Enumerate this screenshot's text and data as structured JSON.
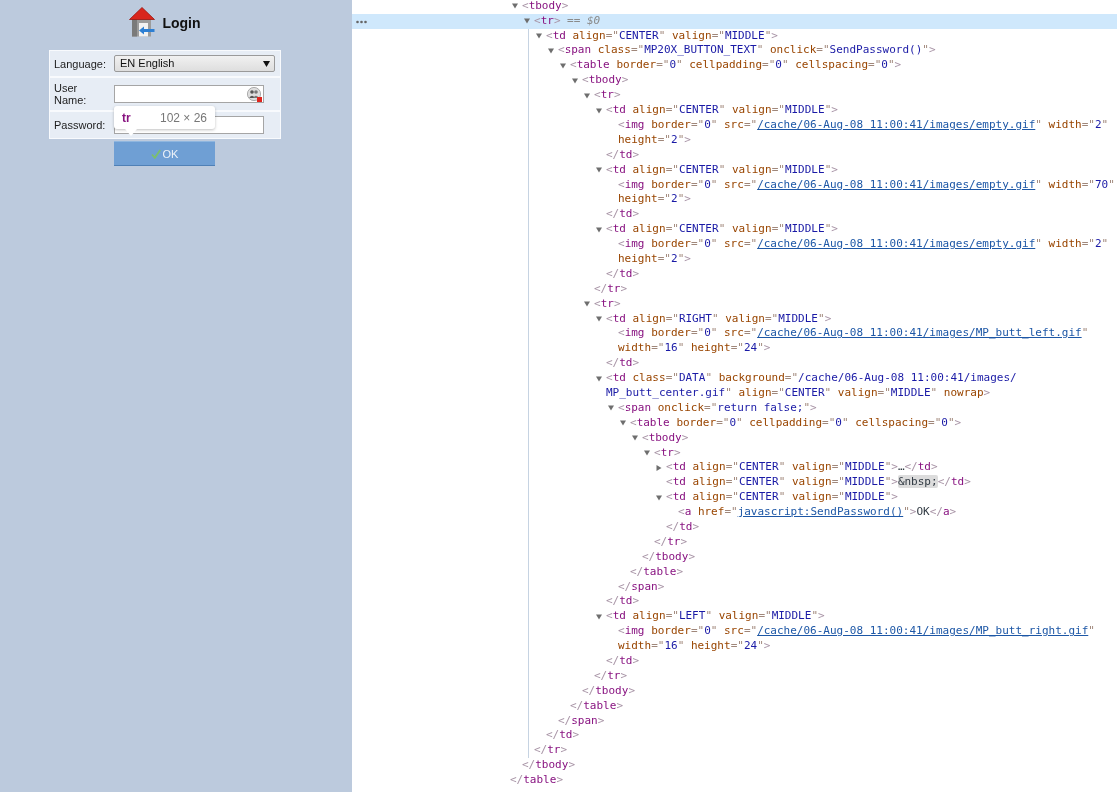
{
  "login_page": {
    "title": "Login",
    "fields": [
      {
        "label": "Language:",
        "kind": "select",
        "value": "EN English"
      },
      {
        "label": "User Name:",
        "kind": "text"
      },
      {
        "label": "Password:",
        "kind": "password"
      }
    ],
    "submit_button": "OK"
  },
  "inspect_tooltip": {
    "tag": "tr",
    "size": "102 × 26"
  },
  "elements_panel": {
    "tree": {
      "close": "</table>",
      "children": [
        {
          "kind": "parent",
          "open": [
            {
              "kind": "markup",
              "text": "<tbody>"
            }
          ],
          "expanded": true,
          "selected": false,
          "close": "</tbody>",
          "children": [
            {
              "kind": "parent",
              "open": [
                {
                  "kind": "markup",
                  "text": "<tr>"
                }
              ],
              "suffix": "== $0",
              "expanded": true,
              "selected": true,
              "close": "</tr>",
              "children": [
                {
                  "kind": "parent",
                  "open": [
                    {
                      "kind": "markup",
                      "text": "<td align=\"CENTER\" valign=\"MIDDLE\">"
                    }
                  ],
                  "expanded": true,
                  "selected": false,
                  "close": "</td>",
                  "children": [
                    {
                      "kind": "parent",
                      "open": [
                        {
                          "kind": "markup",
                          "text": "<span class=\"MP20X_BUTTON_TEXT\" onclick=\"SendPassword()\">"
                        }
                      ],
                      "expanded": true,
                      "selected": false,
                      "close": "</span>",
                      "children": [
                        {
                          "kind": "parent",
                          "open": [
                            {
                              "kind": "markup",
                              "text": "<table border=\"0\" cellpadding=\"0\" cellspacing=\"0\">"
                            }
                          ],
                          "expanded": true,
                          "selected": false,
                          "close": "</table>",
                          "children": [
                            {
                              "kind": "parent",
                              "open": [
                                {
                                  "kind": "markup",
                                  "text": "<tbody>"
                                }
                              ],
                              "expanded": true,
                              "selected": false,
                              "close": "</tbody>",
                              "children": [
                                {
                                  "kind": "parent",
                                  "open": [
                                    {
                                      "kind": "markup",
                                      "text": "<tr>"
                                    }
                                  ],
                                  "expanded": true,
                                  "selected": false,
                                  "close": "</tr>",
                                  "children": [
                                    {
                                      "kind": "parent",
                                      "open": [
                                        {
                                          "kind": "markup",
                                          "text": "<td align=\"CENTER\" valign=\"MIDDLE\">"
                                        }
                                      ],
                                      "expanded": true,
                                      "selected": false,
                                      "close": "</td>",
                                      "children": [
                                        {
                                          "kind": "leaf",
                                          "open": [
                                            {
                                              "kind": "markup",
                                              "text": "<img border=\"0\" src=\""
                                            },
                                            {
                                              "kind": "link",
                                              "text": "/cache/06-Aug-08 11:00:41/images/empty.gif"
                                            },
                                            {
                                              "kind": "markup",
                                              "text": "\" width=\"2\""
                                            },
                                            {
                                              "kind": "markup",
                                              "text": " height=\"2\">"
                                            }
                                          ],
                                          "selected": false
                                        }
                                      ]
                                    },
                                    {
                                      "kind": "parent",
                                      "open": [
                                        {
                                          "kind": "markup",
                                          "text": "<td align=\"CENTER\" valign=\"MIDDLE\">"
                                        }
                                      ],
                                      "expanded": true,
                                      "selected": false,
                                      "close": "</td>",
                                      "children": [
                                        {
                                          "kind": "leaf",
                                          "open": [
                                            {
                                              "kind": "markup",
                                              "text": "<img border=\"0\" src=\""
                                            },
                                            {
                                              "kind": "link",
                                              "text": "/cache/06-Aug-08 11:00:41/images/empty.gif"
                                            },
                                            {
                                              "kind": "markup",
                                              "text": "\" width=\"70\""
                                            },
                                            {
                                              "kind": "markup",
                                              "text": " height=\"2\">"
                                            }
                                          ],
                                          "selected": false
                                        }
                                      ]
                                    },
                                    {
                                      "kind": "parent",
                                      "open": [
                                        {
                                          "kind": "markup",
                                          "text": "<td align=\"CENTER\" valign=\"MIDDLE\">"
                                        }
                                      ],
                                      "expanded": true,
                                      "selected": false,
                                      "close": "</td>",
                                      "children": [
                                        {
                                          "kind": "leaf",
                                          "open": [
                                            {
                                              "kind": "markup",
                                              "text": "<img border=\"0\" src=\""
                                            },
                                            {
                                              "kind": "link",
                                              "text": "/cache/06-Aug-08 11:00:41/images/empty.gif"
                                            },
                                            {
                                              "kind": "markup",
                                              "text": "\" width=\"2\""
                                            },
                                            {
                                              "kind": "markup",
                                              "text": " height=\"2\">"
                                            }
                                          ],
                                          "selected": false
                                        }
                                      ]
                                    }
                                  ]
                                },
                                {
                                  "kind": "parent",
                                  "open": [
                                    {
                                      "kind": "markup",
                                      "text": "<tr>"
                                    }
                                  ],
                                  "expanded": true,
                                  "selected": false,
                                  "close": "</tr>",
                                  "children": [
                                    {
                                      "kind": "parent",
                                      "open": [
                                        {
                                          "kind": "markup",
                                          "text": "<td align=\"RIGHT\" valign=\"MIDDLE\">"
                                        }
                                      ],
                                      "expanded": true,
                                      "selected": false,
                                      "close": "</td>",
                                      "children": [
                                        {
                                          "kind": "leaf",
                                          "open": [
                                            {
                                              "kind": "markup",
                                              "text": "<img border=\"0\" src=\""
                                            },
                                            {
                                              "kind": "link",
                                              "text": "/cache/06-Aug-08 11:00:41/images/MP_butt_left.gif"
                                            },
                                            {
                                              "kind": "markup",
                                              "text": "\""
                                            },
                                            {
                                              "kind": "markup",
                                              "text": " width=\"16\" height=\"24\">"
                                            }
                                          ],
                                          "selected": false
                                        }
                                      ]
                                    },
                                    {
                                      "kind": "parent",
                                      "open": [
                                        {
                                          "kind": "markup",
                                          "text": "<td class=\"DATA\" background=\"/cache/06-Aug-08 11:00:41/images/MP_butt_center.gif\" align=\"CENTER\" valign=\"MIDDLE\" nowrap>"
                                        }
                                      ],
                                      "expanded": true,
                                      "selected": false,
                                      "close": "</td>",
                                      "children": [
                                        {
                                          "kind": "parent",
                                          "open": [
                                            {
                                              "kind": "markup",
                                              "text": "<span onclick=\"return false;\">"
                                            }
                                          ],
                                          "expanded": true,
                                          "selected": false,
                                          "close": "</span>",
                                          "children": [
                                            {
                                              "kind": "parent",
                                              "open": [
                                                {
                                                  "kind": "markup",
                                                  "text": "<table border=\"0\" cellpadding=\"0\" cellspacing=\"0\">"
                                                }
                                              ],
                                              "expanded": true,
                                              "selected": false,
                                              "close": "</table>",
                                              "children": [
                                                {
                                                  "kind": "parent",
                                                  "open": [
                                                    {
                                                      "kind": "markup",
                                                      "text": "<tbody>"
                                                    }
                                                  ],
                                                  "expanded": true,
                                                  "selected": false,
                                                  "close": "</tbody>",
                                                  "children": [
                                                    {
                                                      "kind": "parent",
                                                      "open": [
                                                        {
                                                          "kind": "markup",
                                                          "text": "<tr>"
                                                        }
                                                      ],
                                                      "expanded": true,
                                                      "selected": false,
                                                      "close": "</tr>",
                                                      "children": [
                                                        {
                                                          "kind": "parent",
                                                          "open": [
                                                            {
                                                              "kind": "markup",
                                                              "text": "<td align=\"CENTER\" valign=\"MIDDLE\">"
                                                            }
                                                          ],
                                                          "summary": "…",
                                                          "expanded": false,
                                                          "selected": false,
                                                          "close": "</td>"
                                                        },
                                                        {
                                                          "kind": "inline",
                                                          "open": [
                                                            {
                                                              "kind": "markup",
                                                              "text": "<td align=\"CENTER\" valign=\"MIDDLE\">"
                                                            }
                                                          ],
                                                          "content": {
                                                            "text": "&nbsp;",
                                                            "kind": "entity"
                                                          },
                                                          "close": "</td>",
                                                          "selected": false
                                                        },
                                                        {
                                                          "kind": "parent",
                                                          "open": [
                                                            {
                                                              "kind": "markup",
                                                              "text": "<td align=\"CENTER\" valign=\"MIDDLE\">"
                                                            }
                                                          ],
                                                          "expanded": true,
                                                          "selected": false,
                                                          "close": "</td>",
                                                          "children": [
                                                            {
                                                              "kind": "inline",
                                                              "open": [
                                                                {
                                                                  "kind": "markup",
                                                                  "text": "<a href=\""
                                                                },
                                                                {
                                                                  "kind": "link",
                                                                  "text": "javascript:SendPassword()"
                                                                },
                                                                {
                                                                  "kind": "markup",
                                                                  "text": "\">"
                                                                }
                                                              ],
                                                              "content": {
                                                                "text": "OK",
                                                                "kind": "text"
                                                              },
                                                              "close": "</a>",
                                                              "selected": false
                                                            }
                                                          ]
                                                        }
                                                      ]
                                                    }
                                                  ]
                                                }
                                              ]
                                            }
                                          ]
                                        }
                                      ]
                                    },
                                    {
                                      "kind": "parent",
                                      "open": [
                                        {
                                          "kind": "markup",
                                          "text": "<td align=\"LEFT\" valign=\"MIDDLE\">"
                                        }
                                      ],
                                      "expanded": true,
                                      "selected": false,
                                      "close": "</td>",
                                      "children": [
                                        {
                                          "kind": "leaf",
                                          "open": [
                                            {
                                              "kind": "markup",
                                              "text": "<img border=\"0\" src=\""
                                            },
                                            {
                                              "kind": "link",
                                              "text": "/cache/06-Aug-08 11:00:41/images/MP_butt_right.gif"
                                            },
                                            {
                                              "kind": "markup",
                                              "text": "\""
                                            },
                                            {
                                              "kind": "markup",
                                              "text": " width=\"16\" height=\"24\">"
                                            }
                                          ],
                                          "selected": false
                                        }
                                      ]
                                    }
                                  ]
                                }
                              ]
                            }
                          ]
                        }
                      ]
                    }
                  ]
                }
              ]
            }
          ]
        }
      ]
    }
  }
}
